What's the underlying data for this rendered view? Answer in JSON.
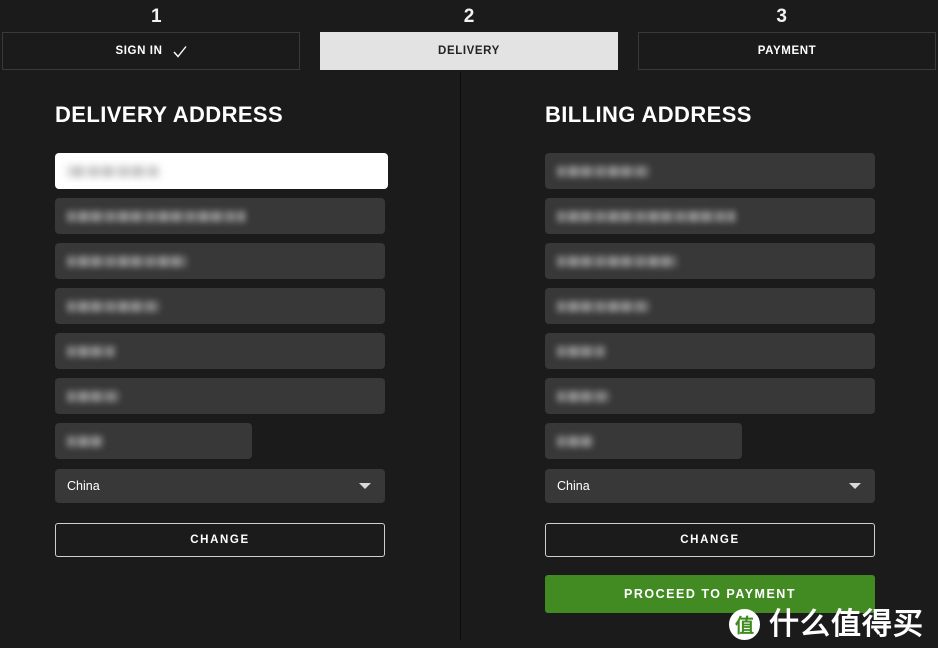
{
  "checkout": {
    "steps": [
      {
        "number": "1",
        "label": "SIGN IN",
        "state": "completed",
        "icon": "check-icon"
      },
      {
        "number": "2",
        "label": "DELIVERY",
        "state": "active",
        "icon": null
      },
      {
        "number": "3",
        "label": "PAYMENT",
        "state": "upcoming",
        "icon": null
      }
    ]
  },
  "delivery": {
    "title": "DELIVERY ADDRESS",
    "fields": [
      {
        "name": "name-field",
        "value": "",
        "redacted": true,
        "focused": true,
        "width": "wide",
        "text_width": "r-w3"
      },
      {
        "name": "address-line-1-field",
        "value": "",
        "redacted": true,
        "focused": false,
        "width": "wide",
        "text_width": "r-w2"
      },
      {
        "name": "address-line-2-field",
        "value": "",
        "redacted": true,
        "focused": false,
        "width": "wide",
        "text_width": "r-w1"
      },
      {
        "name": "city-field",
        "value": "",
        "redacted": true,
        "focused": false,
        "width": "wide",
        "text_width": "r-w3"
      },
      {
        "name": "postal-code-field",
        "value": "",
        "redacted": true,
        "focused": false,
        "width": "wide",
        "text_width": "r-w5"
      },
      {
        "name": "province-field",
        "value": "",
        "redacted": true,
        "focused": false,
        "width": "wide",
        "text_width": "r-w6"
      },
      {
        "name": "phone-field",
        "value": "",
        "redacted": true,
        "focused": false,
        "width": "narrow",
        "text_width": "r-w7"
      }
    ],
    "country": {
      "label": "China",
      "icon": "chevron-down-icon"
    },
    "change_label": "CHANGE"
  },
  "billing": {
    "title": "BILLING ADDRESS",
    "fields": [
      {
        "name": "name-field",
        "value": "",
        "redacted": true,
        "focused": false,
        "width": "wide",
        "text_width": "r-w3"
      },
      {
        "name": "address-line-1-field",
        "value": "",
        "redacted": true,
        "focused": false,
        "width": "wide",
        "text_width": "r-w2"
      },
      {
        "name": "address-line-2-field",
        "value": "",
        "redacted": true,
        "focused": false,
        "width": "wide",
        "text_width": "r-w1"
      },
      {
        "name": "city-field",
        "value": "",
        "redacted": true,
        "focused": false,
        "width": "wide",
        "text_width": "r-w3"
      },
      {
        "name": "postal-code-field",
        "value": "",
        "redacted": true,
        "focused": false,
        "width": "wide",
        "text_width": "r-w5"
      },
      {
        "name": "province-field",
        "value": "",
        "redacted": true,
        "focused": false,
        "width": "wide",
        "text_width": "r-w6"
      },
      {
        "name": "phone-field",
        "value": "",
        "redacted": true,
        "focused": false,
        "width": "narrow",
        "text_width": "r-w7"
      }
    ],
    "country": {
      "label": "China",
      "icon": "chevron-down-icon"
    },
    "change_label": "CHANGE",
    "proceed_label": "PROCEED TO PAYMENT"
  },
  "watermark": {
    "badge": "值",
    "text": "什么值得买"
  },
  "colors": {
    "background": "#1b1b1b",
    "field": "#383838",
    "active_tab": "#e3e3e3",
    "accent_green": "#428b22",
    "border": "#3a3a3a"
  }
}
